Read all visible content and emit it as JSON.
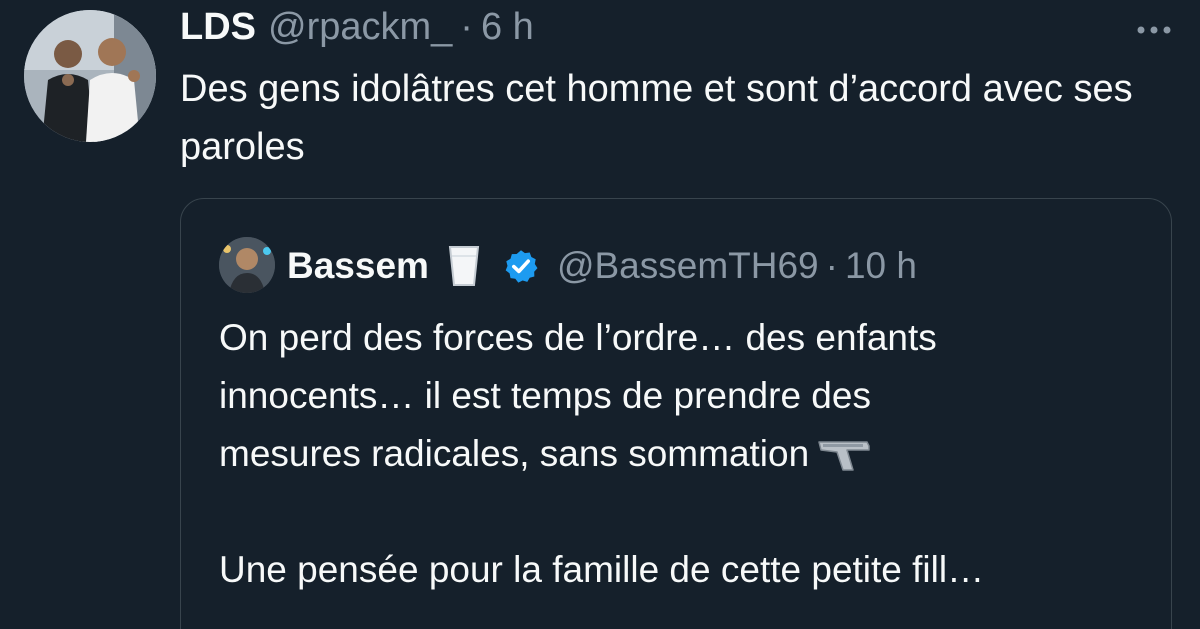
{
  "tweet": {
    "display_name": "LDS",
    "handle": "@rpackm_",
    "separator": "·",
    "time": "6 h",
    "text": "Des gens idolâtres cet homme et sont d’accord avec ses paroles",
    "more_icon": "more-horizontal-icon"
  },
  "quote": {
    "display_name": "Bassem",
    "name_emoji": "milk-glass-icon",
    "verified_icon": "verified-badge-icon",
    "handle": "@BassemTH69",
    "separator": "·",
    "time": "10 h",
    "lines": [
      "On perd des forces de l’ordre… des enfants",
      "innocents… il est temps de prendre des",
      "mesures radicales, sans sommation"
    ],
    "trailing_emoji": "pistol-icon",
    "paragraph2": "Une pensée pour la famille de cette petite fill…"
  },
  "colors": {
    "background": "#15202b",
    "text_primary": "#f7f9f9",
    "text_secondary": "#8b98a5",
    "border": "#38444d",
    "verified_blue": "#1d9bf0"
  }
}
